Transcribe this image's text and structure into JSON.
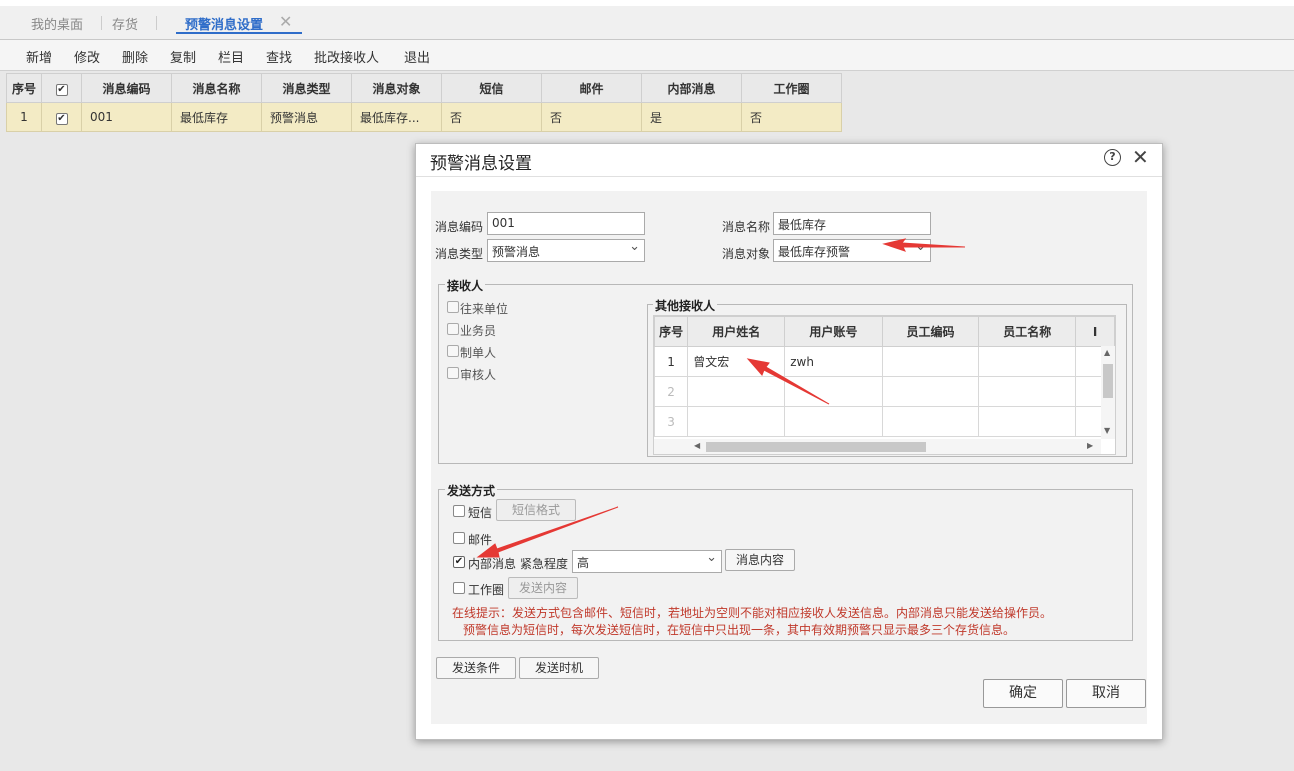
{
  "tabs": [
    {
      "label": "我的桌面"
    },
    {
      "label": "存货"
    },
    {
      "label": "预警消息设置"
    }
  ],
  "tab_close_glyph": "✕",
  "toolbar": {
    "items": [
      "新增",
      "修改",
      "删除",
      "复制",
      "栏目",
      "查找",
      "批改接收人",
      "退出"
    ]
  },
  "main_grid": {
    "columns": [
      "序号",
      "",
      "消息编码",
      "消息名称",
      "消息类型",
      "消息对象",
      "短信",
      "邮件",
      "内部消息",
      "工作圈"
    ],
    "rows": [
      {
        "seq": "1",
        "checked": true,
        "code": "001",
        "name": "最低库存",
        "type": "预警消息",
        "object": "最低库存...",
        "sms": "否",
        "email": "否",
        "internal": "是",
        "workcircle": "否"
      }
    ]
  },
  "dialog": {
    "title": "预警消息设置",
    "help_glyph": "?",
    "close_glyph": "✕",
    "fields": {
      "code_label": "消息编码",
      "code_value": "001",
      "name_label": "消息名称",
      "name_value": "最低库存",
      "type_label": "消息类型",
      "type_value": "预警消息",
      "object_label": "消息对象",
      "object_value": "最低库存预警"
    },
    "receivers": {
      "legend": "接收人",
      "options": [
        {
          "label": "往来单位",
          "checked": false
        },
        {
          "label": "业务员",
          "checked": false
        },
        {
          "label": "制单人",
          "checked": false
        },
        {
          "label": "审核人",
          "checked": false
        }
      ],
      "other_legend": "其他接收人",
      "grid_columns": [
        "序号",
        "用户姓名",
        "用户账号",
        "员工编码",
        "员工名称"
      ],
      "grid_rows": [
        {
          "seq": "1",
          "user_name": "曾文宏",
          "account": "zwh",
          "emp_code": "",
          "emp_name": ""
        },
        {
          "seq": "2",
          "user_name": "",
          "account": "",
          "emp_code": "",
          "emp_name": ""
        },
        {
          "seq": "3",
          "user_name": "",
          "account": "",
          "emp_code": "",
          "emp_name": ""
        }
      ]
    },
    "send": {
      "legend": "发送方式",
      "sms_label": "短信",
      "sms_checked": false,
      "sms_format_button": "短信格式",
      "email_label": "邮件",
      "email_checked": false,
      "internal_label": "内部消息",
      "internal_checked": true,
      "urgency_label": "紧急程度",
      "urgency_value": "高",
      "content_button": "消息内容",
      "workcircle_label": "工作圈",
      "workcircle_checked": false,
      "send_content_button": "发送内容",
      "hint_line1": "在线提示：发送方式包含邮件、短信时，若地址为空则不能对相应接收人发送信息。内部消息只能发送给操作员。",
      "hint_line2": "预警信息为短信时，每次发送短信时，在短信中只出现一条，其中有效期预警只显示最多三个存货信息。"
    },
    "buttons": {
      "condition": "发送条件",
      "timing": "发送时机",
      "ok": "确定",
      "cancel": "取消"
    }
  },
  "colors": {
    "accent": "#2f6dc9",
    "row_highlight": "#f3ebc5",
    "warning_text": "#c0392b",
    "arrow": "#e53935"
  }
}
